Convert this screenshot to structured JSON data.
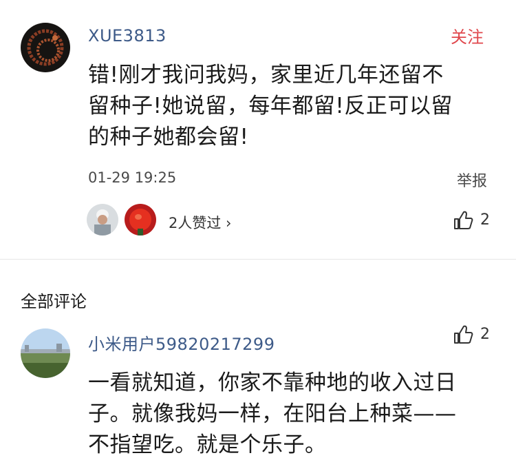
{
  "reply": {
    "username": "XUE3813",
    "follow_label": "关注",
    "text_lines": [
      "错!刚才我问我妈，家里近几年还留不",
      "留种子!她说留，每年都留!反正可以留",
      "的种子她都会留!"
    ],
    "timestamp": "01-29 19:25",
    "report_label": "举报",
    "likers_text": "2人赞过 ›",
    "like_count": "2"
  },
  "section": {
    "title": "全部评论"
  },
  "comment": {
    "username": "小米用户59820217299",
    "like_count": "2",
    "text_lines": [
      "一看就知道，你家不靠种地的收入过日",
      "子。就像我妈一样，在阳台上种菜——",
      "不指望吃。就是个乐子。"
    ]
  },
  "colors": {
    "username": "#3d5a88",
    "follow": "#e0474c",
    "divider": "#e6e6e6"
  },
  "icons": [
    "avatar",
    "thumbs-up-icon",
    "chevron-right-icon"
  ]
}
